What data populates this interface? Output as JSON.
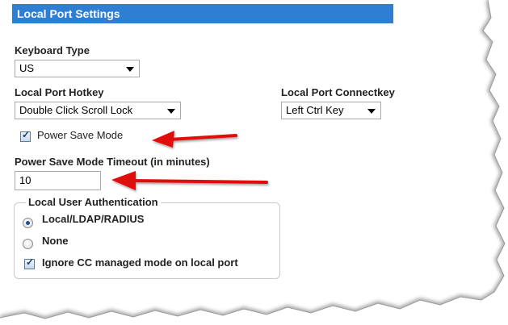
{
  "header": {
    "title": "Local Port Settings"
  },
  "keyboard_type": {
    "label": "Keyboard Type",
    "value": "US"
  },
  "local_port_hotkey": {
    "label": "Local Port Hotkey",
    "value": "Double Click Scroll Lock"
  },
  "local_port_connectkey": {
    "label": "Local Port Connectkey",
    "value": "Left Ctrl Key"
  },
  "power_save_mode": {
    "label": "Power Save Mode",
    "checked": true
  },
  "power_save_timeout": {
    "label": "Power Save Mode Timeout (in minutes)",
    "value": "10"
  },
  "local_user_auth": {
    "legend": "Local User Authentication",
    "options": [
      {
        "label": "Local/LDAP/RADIUS",
        "selected": true
      },
      {
        "label": "None",
        "selected": false
      }
    ],
    "ignore_cc": {
      "label": "Ignore CC managed mode on local port",
      "checked": true
    }
  },
  "colors": {
    "header_bg": "#2e7fd3",
    "annotation_arrow": "#e01010"
  }
}
